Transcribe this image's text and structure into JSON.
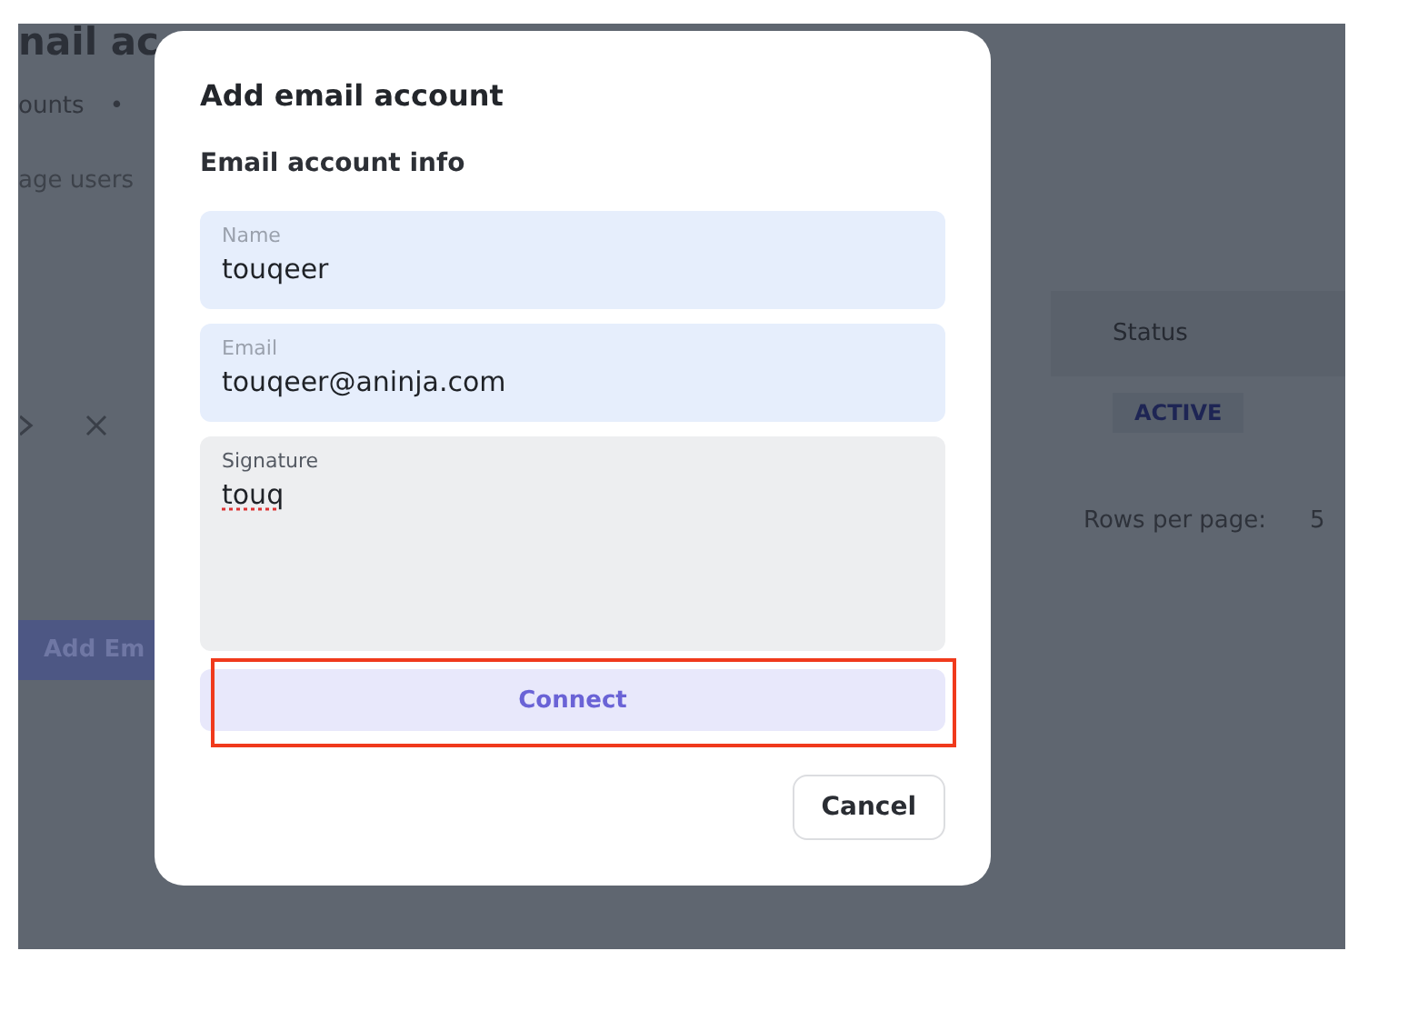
{
  "page": {
    "title": "nail ac",
    "breadcrumb": [
      "ounts",
      "•"
    ],
    "subtitle": "age users",
    "add_button": "Add Em",
    "table": {
      "header": "Status",
      "status": "ACTIVE"
    },
    "pagination": {
      "label": "Rows per page:",
      "value": "5"
    }
  },
  "dialog": {
    "title": "Add email account",
    "section": "Email account info",
    "fields": [
      {
        "kind": "input",
        "label": "Name",
        "value": "touqeer"
      },
      {
        "kind": "input",
        "label": "Email",
        "value": "touqeer@aninja.com"
      },
      {
        "kind": "textarea",
        "label": "Signature",
        "value": "touq"
      }
    ],
    "connect": {
      "label": "Connect",
      "highlighted": true
    },
    "cancel": "Cancel"
  }
}
